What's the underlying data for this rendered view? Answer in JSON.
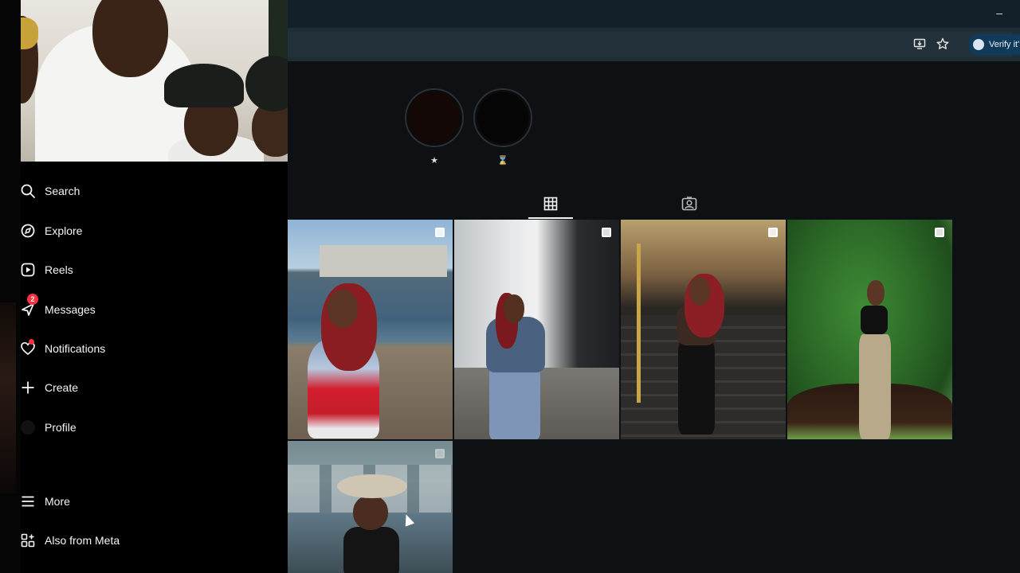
{
  "sidebar": {
    "items": [
      {
        "label": "Search",
        "icon": "search-icon"
      },
      {
        "label": "Explore",
        "icon": "compass-icon"
      },
      {
        "label": "Reels",
        "icon": "reels-icon"
      },
      {
        "label": "Messages",
        "icon": "messenger-icon",
        "badge": "2"
      },
      {
        "label": "Notifications",
        "icon": "heart-icon"
      },
      {
        "label": "Create",
        "icon": "plus-icon"
      },
      {
        "label": "Profile",
        "icon": "avatar"
      },
      {
        "label": "More",
        "icon": "menu-icon"
      },
      {
        "label": "Also from Meta",
        "icon": "meta-apps-icon"
      }
    ]
  },
  "browser": {
    "minimize_glyph": "–",
    "verify_label": "Verify it'"
  },
  "highlights": [
    {
      "label": "★"
    },
    {
      "label": "⌛"
    }
  ],
  "tabs": [
    {
      "name": "posts",
      "icon": "grid-icon",
      "active": true
    },
    {
      "name": "tagged",
      "icon": "tagged-icon",
      "active": false
    }
  ],
  "colors": {
    "accent_badge": "#ff3040",
    "main_bg": "#0d1114",
    "chrome_bg": "#1e2c33",
    "verify_pill": "#0f3a5a"
  }
}
